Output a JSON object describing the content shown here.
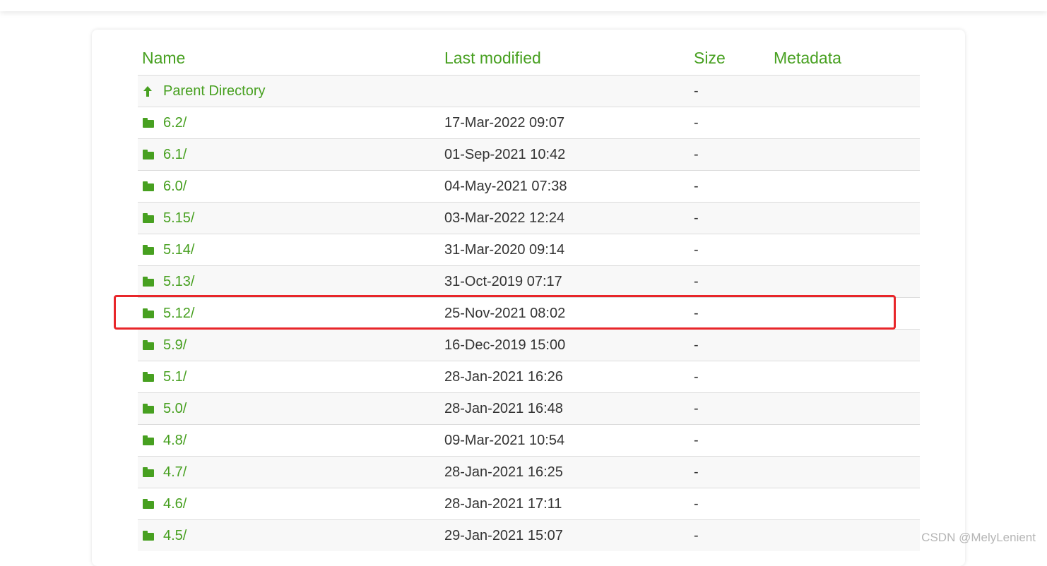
{
  "columns": {
    "name": "Name",
    "last_modified": "Last modified",
    "size": "Size",
    "metadata": "Metadata"
  },
  "parent": {
    "label": "Parent Directory",
    "size": "-"
  },
  "entries": [
    {
      "name": "6.2/",
      "modified": "17-Mar-2022 09:07",
      "size": "-"
    },
    {
      "name": "6.1/",
      "modified": "01-Sep-2021 10:42",
      "size": "-"
    },
    {
      "name": "6.0/",
      "modified": "04-May-2021 07:38",
      "size": "-"
    },
    {
      "name": "5.15/",
      "modified": "03-Mar-2022 12:24",
      "size": "-"
    },
    {
      "name": "5.14/",
      "modified": "31-Mar-2020 09:14",
      "size": "-"
    },
    {
      "name": "5.13/",
      "modified": "31-Oct-2019 07:17",
      "size": "-"
    },
    {
      "name": "5.12/",
      "modified": "25-Nov-2021 08:02",
      "size": "-"
    },
    {
      "name": "5.9/",
      "modified": "16-Dec-2019 15:00",
      "size": "-"
    },
    {
      "name": "5.1/",
      "modified": "28-Jan-2021 16:26",
      "size": "-"
    },
    {
      "name": "5.0/",
      "modified": "28-Jan-2021 16:48",
      "size": "-"
    },
    {
      "name": "4.8/",
      "modified": "09-Mar-2021 10:54",
      "size": "-"
    },
    {
      "name": "4.7/",
      "modified": "28-Jan-2021 16:25",
      "size": "-"
    },
    {
      "name": "4.6/",
      "modified": "28-Jan-2021 17:11",
      "size": "-"
    },
    {
      "name": "4.5/",
      "modified": "29-Jan-2021 15:07",
      "size": "-"
    }
  ],
  "watermark": "CSDN @MelyLenient",
  "colors": {
    "link": "#47a020",
    "highlight": "#e8262a"
  }
}
